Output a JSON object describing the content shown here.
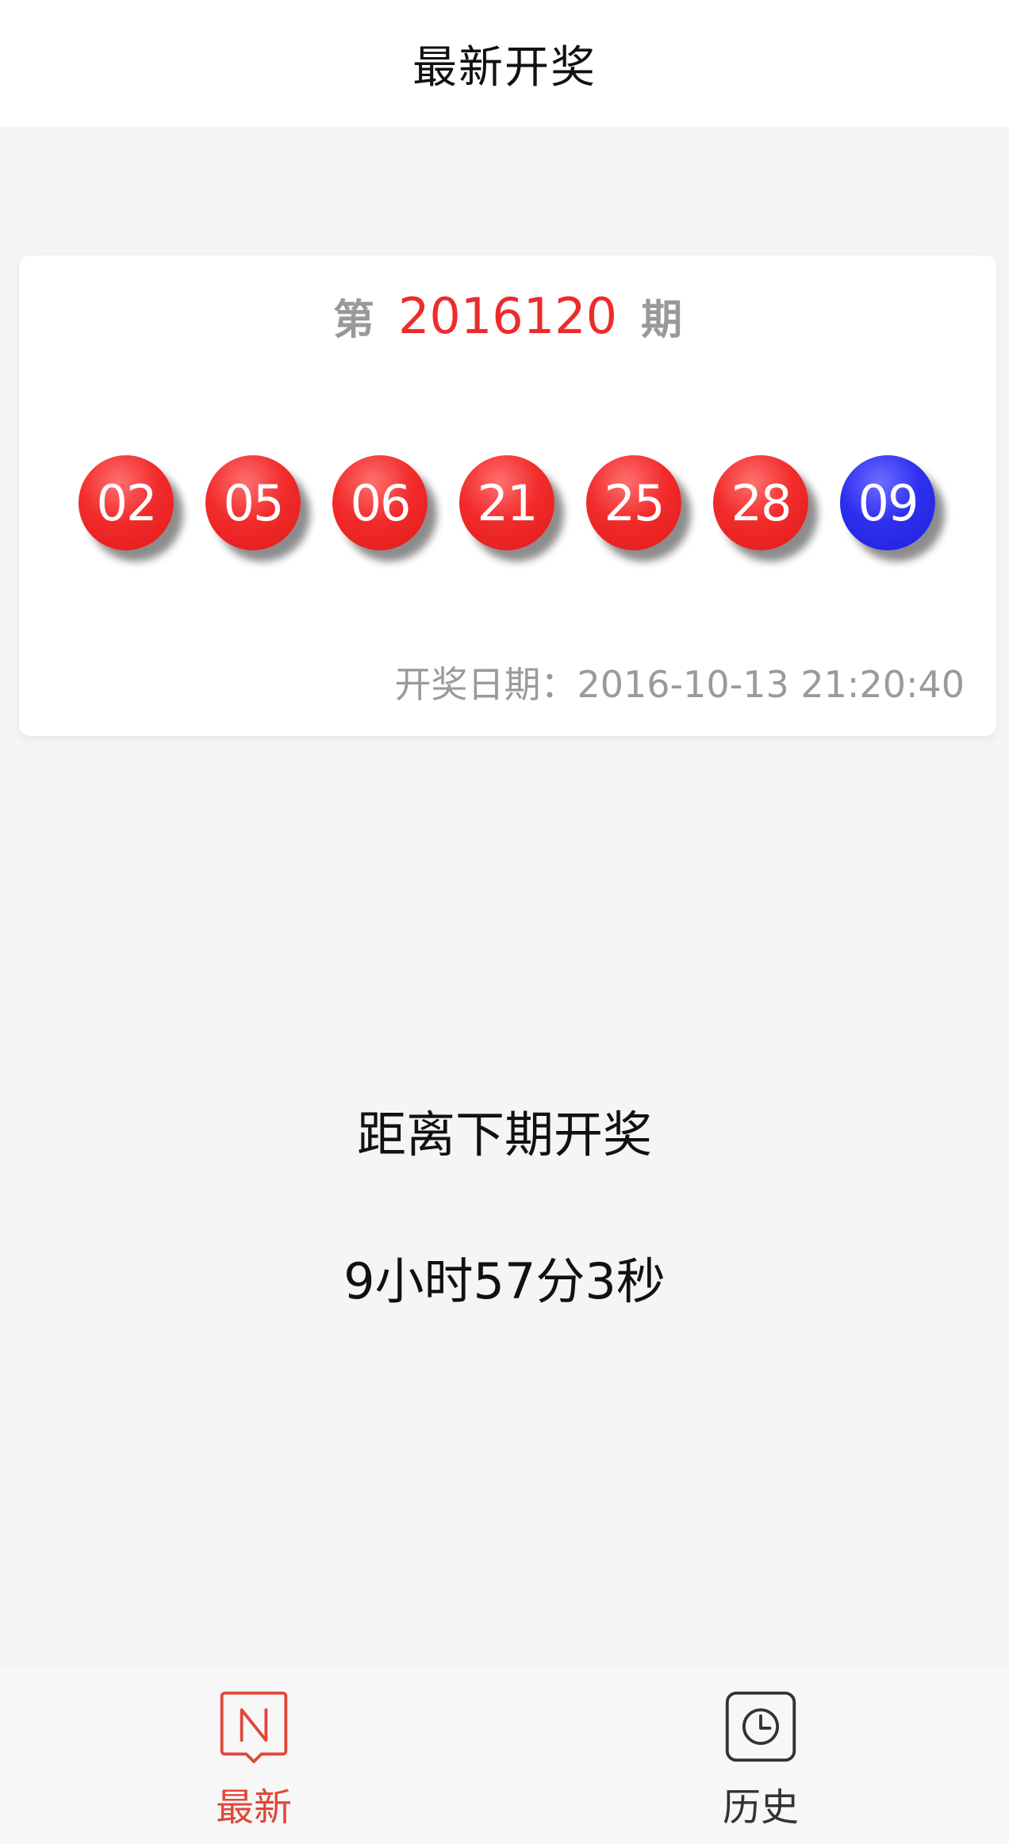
{
  "header": {
    "title": "最新开奖"
  },
  "draw": {
    "prefix": "第",
    "issue": "2016120",
    "suffix": "期",
    "balls": [
      {
        "number": "02",
        "color": "red"
      },
      {
        "number": "05",
        "color": "red"
      },
      {
        "number": "06",
        "color": "red"
      },
      {
        "number": "21",
        "color": "red"
      },
      {
        "number": "25",
        "color": "red"
      },
      {
        "number": "28",
        "color": "red"
      },
      {
        "number": "09",
        "color": "blue"
      }
    ],
    "date_text": "开奖日期：2016-10-13 21:20:40"
  },
  "countdown": {
    "label": "距离下期开奖",
    "value": "9小时57分3秒"
  },
  "tabbar": {
    "tabs": [
      {
        "label": "最新",
        "icon": "latest-n-icon",
        "active": true
      },
      {
        "label": "历史",
        "icon": "clock-icon",
        "active": false
      }
    ]
  },
  "colors": {
    "accent_red": "#ee2b2b",
    "ball_red": "#f22b2b",
    "ball_blue": "#2f2ff0",
    "tab_active": "#e0473a",
    "muted_text": "#999999"
  }
}
